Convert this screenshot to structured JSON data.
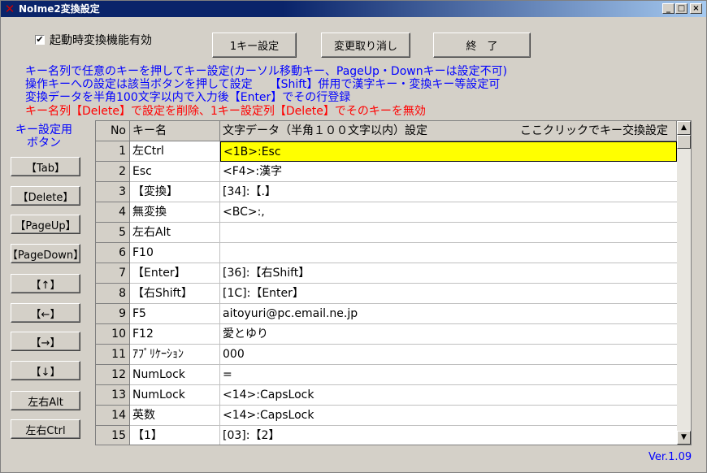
{
  "window": {
    "title": "NoIme2変換設定",
    "icon": "x-app-icon"
  },
  "titlebar_buttons": {
    "minimize": "_",
    "maximize": "□",
    "close": "×"
  },
  "startup_checkbox": {
    "label": "起動時変換機能有効",
    "checked": true,
    "mark": "✔"
  },
  "top_buttons": {
    "one_key": "1キー設定",
    "undo": "変更取り消し",
    "exit": "終　了"
  },
  "instructions": [
    "キー名列で任意のキーを押してキー設定(カーソル移動キー、PageUp・Downキーは設定不可)",
    "操作キーへの設定は該当ボタンを押して設定　　【Shift】併用で漢字キー・変換キー等設定可",
    "変換データを半角100文字以内で入力後【Enter】でその行登録"
  ],
  "warning": "キー名列【Delete】で設定を削除、1キー設定列【Delete】でそのキーを無効",
  "side_label": [
    "キー設定用",
    "ボタン"
  ],
  "side_buttons": [
    "【Tab】",
    "【Delete】",
    "【PageUp】",
    "【PageDown】",
    "【↑】",
    "【←】",
    "【→】",
    "【↓】",
    "左右Alt",
    "左右Ctrl"
  ],
  "grid": {
    "headers": {
      "no": "No",
      "key": "キー名",
      "data": "文字データ（半角１００文字以内）設定",
      "swap": "ここクリックでキー交換設定"
    },
    "rows": [
      {
        "no": "1",
        "key": "左Ctrl",
        "data": "<1B>:Esc",
        "selected": true
      },
      {
        "no": "2",
        "key": "Esc",
        "data": "<F4>:漢字"
      },
      {
        "no": "3",
        "key": "【変換】",
        "data": "[34]:【.】"
      },
      {
        "no": "4",
        "key": "無変換",
        "data": "<BC>:,"
      },
      {
        "no": "5",
        "key": "左右Alt",
        "data": ""
      },
      {
        "no": "6",
        "key": "F10",
        "data": ""
      },
      {
        "no": "7",
        "key": "【Enter】",
        "data": "[36]:【右Shift】"
      },
      {
        "no": "8",
        "key": "【右Shift】",
        "data": "[1C]:【Enter】"
      },
      {
        "no": "9",
        "key": "F5",
        "data": "aitoyuri@pc.email.ne.jp"
      },
      {
        "no": "10",
        "key": "F12",
        "data": "愛とゆり"
      },
      {
        "no": "11",
        "key": "ｱﾌﾟﾘｹｰｼｮﾝ",
        "data": "000"
      },
      {
        "no": "12",
        "key": "NumLock",
        "data": "="
      },
      {
        "no": "13",
        "key": "NumLock",
        "data": "<14>:CapsLock"
      },
      {
        "no": "14",
        "key": "英数",
        "data": "<14>:CapsLock"
      },
      {
        "no": "15",
        "key": "【1】",
        "data": "[03]:【2】"
      }
    ]
  },
  "scroll_arrows": {
    "up": "▲",
    "down": "▼"
  },
  "version": "Ver.1.09"
}
